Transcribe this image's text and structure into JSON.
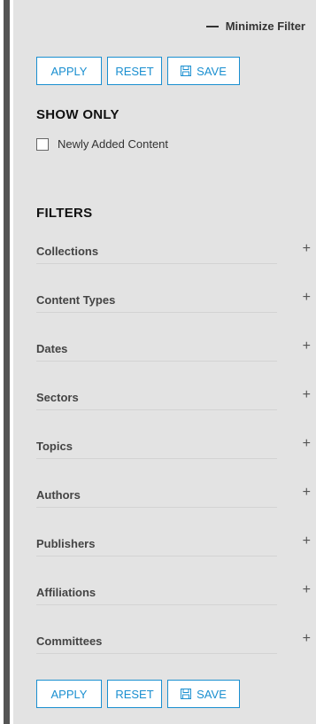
{
  "header": {
    "minimize_label": "Minimize Filter"
  },
  "buttons": {
    "apply": "APPLY",
    "reset": "RESET",
    "save": "SAVE"
  },
  "show_only": {
    "title": "SHOW ONLY",
    "checkbox_label": "Newly Added Content",
    "checked": false
  },
  "filters": {
    "title": "FILTERS",
    "expand_symbol": "+",
    "items": [
      {
        "label": "Collections"
      },
      {
        "label": "Content Types"
      },
      {
        "label": "Dates"
      },
      {
        "label": "Sectors"
      },
      {
        "label": "Topics"
      },
      {
        "label": "Authors"
      },
      {
        "label": "Publishers"
      },
      {
        "label": "Affiliations"
      },
      {
        "label": "Committees"
      }
    ]
  },
  "colors": {
    "accent": "#1a8fd0",
    "panel": "#e3e3e3"
  }
}
